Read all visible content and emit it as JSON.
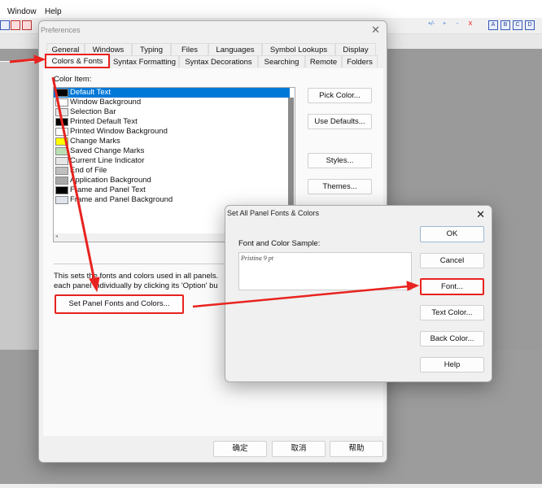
{
  "menubar": {
    "items": [
      "Window",
      "Help"
    ]
  },
  "toolbar": {
    "icons": [
      "find-icon",
      "upload-icon",
      "download-icon",
      "add-icon",
      "insert-icon",
      "subtract-icon",
      "delete-icon",
      "letter-a-icon",
      "letter-b-icon",
      "letter-c-icon",
      "letter-d-icon"
    ],
    "letters": [
      "A",
      "B",
      "C",
      "D"
    ],
    "glyphs": [
      "+/-",
      "+",
      "-",
      "X"
    ]
  },
  "preferences": {
    "title": "Preferences",
    "tabs_row1": [
      "General",
      "Windows",
      "Typing",
      "Files",
      "Languages",
      "Symbol Lookups",
      "Display"
    ],
    "tabs_row2": [
      "Colors & Fonts",
      "Syntax Formatting",
      "Syntax Decorations",
      "Searching",
      "Remote",
      "Folders"
    ],
    "active_tab": "Colors & Fonts",
    "color_item_label": "Color Item:",
    "color_items": [
      {
        "label": "Default Text",
        "color": "#000000",
        "selected": true
      },
      {
        "label": "Window Background",
        "color": "#ffffff"
      },
      {
        "label": "Selection Bar",
        "color": "#e6e6e6"
      },
      {
        "label": "Printed Default Text",
        "color": "#000000"
      },
      {
        "label": "Printed Window Background",
        "color": "#ffffff"
      },
      {
        "label": "Change Marks",
        "color": "#ffff00"
      },
      {
        "label": "Saved Change Marks",
        "color": "#b9e0b5"
      },
      {
        "label": "Current Line Indicator",
        "color": "#e6e6e6"
      },
      {
        "label": "End of File",
        "color": "#c0c0c0"
      },
      {
        "label": "Application Background",
        "color": "#a8a8a8"
      },
      {
        "label": "Frame and Panel Text",
        "color": "#000000"
      },
      {
        "label": "Frame and Panel Background",
        "color": "#dfe4ec"
      }
    ],
    "side_buttons": [
      "Pick Color...",
      "Use Defaults...",
      "Styles...",
      "Themes..."
    ],
    "description_line1": "This sets the fonts and colors used in all panels.",
    "description_line2": "each panel individually by clicking its 'Option' bu",
    "set_panel_button": "Set Panel Fonts and Colors...",
    "footer_buttons": [
      "确定",
      "取消",
      "帮助"
    ]
  },
  "set_all_dialog": {
    "title": "Set All Panel Fonts & Colors",
    "sample_label": "Font and Color Sample:",
    "sample_text": "Pristina 9 pt",
    "buttons": [
      "OK",
      "Cancel",
      "Font...",
      "Text Color...",
      "Back Color...",
      "Help"
    ]
  },
  "colors": {
    "selection": "#0078d7",
    "annotation": "#e8231f"
  }
}
